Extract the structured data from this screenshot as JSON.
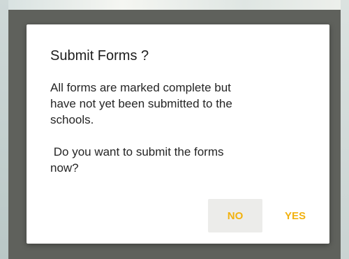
{
  "dialog": {
    "title": "Submit Forms ?",
    "message": "All forms are marked complete but\nhave not yet been submitted to the\nschools.\n\n Do you want to submit the forms\nnow?",
    "buttons": {
      "no": "NO",
      "yes": "YES"
    }
  },
  "colors": {
    "accent": "#f2b20f",
    "scrim": "#5f615c",
    "dialog_background": "#ffffff"
  }
}
